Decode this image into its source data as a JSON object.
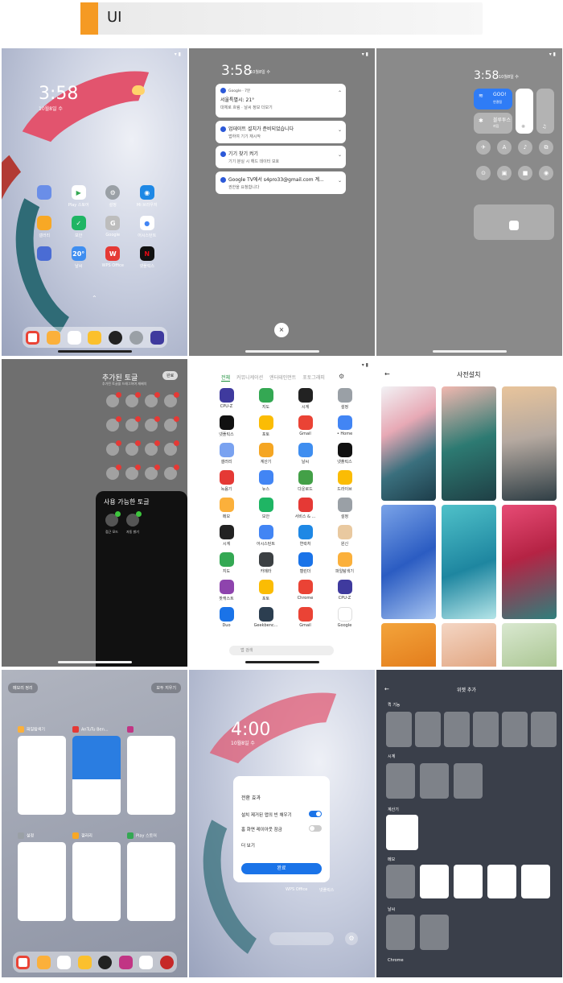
{
  "header": {
    "label": "UI"
  },
  "home": {
    "time": "3:58",
    "date": "10월8일 수",
    "apps": [
      {
        "label": "",
        "color": "#6a8ee8"
      },
      {
        "label": "Play 스토어",
        "color": "#ffffff"
      },
      {
        "label": "설정",
        "color": "#9aa0a6"
      },
      {
        "label": "Mi 브라우저",
        "color": "#1e88e5"
      },
      {
        "label": "갤러리",
        "color": "#f8a825"
      },
      {
        "label": "보안",
        "color": "#1fb564"
      },
      {
        "label": "Google",
        "color": "#bdbdbd"
      },
      {
        "label": "어시스턴트",
        "color": "#ffffff"
      },
      {
        "label": "",
        "color": "#4a6cd4"
      },
      {
        "label": "날씨",
        "color": "#3f8ef0"
      },
      {
        "label": "WPS Office",
        "color": "#e53935"
      },
      {
        "label": "넷플릭스",
        "color": "#111111"
      }
    ]
  },
  "notifications": {
    "time": "3:58",
    "date": "10월8일 수",
    "cards": [
      {
        "title": "Google · 7분",
        "line1": "서울특별시: 21°",
        "line2": "대체로 흐림 · 날씨 정보 더보기"
      },
      {
        "title": "업데이트 설치가 준비되었습니다",
        "line1": "",
        "line2": "앱하여 기기 재시작"
      },
      {
        "title": "기기 찾기 켜기",
        "line1": "",
        "line2": "기기 분실 시 해드 데이터 보호"
      },
      {
        "title": "Google TV에서 s4pro33@gmail.com 계...",
        "line1": "",
        "line2": "권한을 요청합니다"
      }
    ],
    "close": "×"
  },
  "control": {
    "time": "3:58",
    "date": "10월8일 수",
    "wifi_label": "GOO!",
    "wifi_sub": "연결됨",
    "bt_label": "블루투스",
    "bt_sub": "꺼짐"
  },
  "toggles": {
    "title": "추가된 토글",
    "subtitle": "추가된 토글을 드래그하여 재배치",
    "done": "완료",
    "panel_title": "사용 가능한 토글",
    "panel_items": [
      "접근 모드",
      "자동 밝기"
    ]
  },
  "drawer": {
    "tabs": [
      "전체",
      "커뮤니케이션",
      "엔터테인먼트",
      "포토그래피"
    ],
    "apps": [
      {
        "label": "CPU-Z",
        "color": "#3f3a9e"
      },
      {
        "label": "지도",
        "color": "#34a853"
      },
      {
        "label": "시계",
        "color": "#222222"
      },
      {
        "label": "설정",
        "color": "#9aa0a6"
      },
      {
        "label": "넷플릭스",
        "color": "#111111"
      },
      {
        "label": "포토",
        "color": "#fbbc04"
      },
      {
        "label": "Gmail",
        "color": "#ea4335"
      },
      {
        "label": "• Home",
        "color": "#4285f4"
      },
      {
        "label": "갤러리",
        "color": "#7aa2f0"
      },
      {
        "label": "계산기",
        "color": "#f5a623"
      },
      {
        "label": "날씨",
        "color": "#3f8ef0"
      },
      {
        "label": "넷플릭스",
        "color": "#111111"
      },
      {
        "label": "녹음기",
        "color": "#e53935"
      },
      {
        "label": "뉴스",
        "color": "#4285f4"
      },
      {
        "label": "다운로드",
        "color": "#43a047"
      },
      {
        "label": "드라이브",
        "color": "#fbbc04"
      },
      {
        "label": "메모",
        "color": "#fbb03b"
      },
      {
        "label": "보안",
        "color": "#1fb564"
      },
      {
        "label": "서비스 & ...",
        "color": "#e53935"
      },
      {
        "label": "설정",
        "color": "#9aa0a6"
      },
      {
        "label": "시계",
        "color": "#222222"
      },
      {
        "label": "어시스턴트",
        "color": "#4285f4"
      },
      {
        "label": "연락처",
        "color": "#1e88e5"
      },
      {
        "label": "원신",
        "color": "#e9c9a0"
      },
      {
        "label": "지도",
        "color": "#34a853"
      },
      {
        "label": "카메라",
        "color": "#3c4043"
      },
      {
        "label": "캘린더",
        "color": "#1a73e8"
      },
      {
        "label": "파일탐색기",
        "color": "#fbb03b"
      },
      {
        "label": "팟캐스트",
        "color": "#8e44ad"
      },
      {
        "label": "포토",
        "color": "#fbbc04"
      },
      {
        "label": "Chrome",
        "color": "#ea4335"
      },
      {
        "label": "CPU-Z",
        "color": "#3f3a9e"
      },
      {
        "label": "Duo",
        "color": "#1a73e8"
      },
      {
        "label": "Geekbenc...",
        "color": "#2c3e50"
      },
      {
        "label": "Gmail",
        "color": "#ea4335"
      },
      {
        "label": "Google",
        "color": "#ffffff"
      }
    ],
    "search": "앱 검색"
  },
  "wallpaper": {
    "title": "사전설치",
    "back": "←"
  },
  "recents": {
    "left_button": "메모리 정리",
    "right_button": "모두 지우기",
    "cards": [
      {
        "label": "파일탐색기",
        "color": "#fbb03b"
      },
      {
        "label": "AnTuTu Ben...",
        "color": "#e53935"
      },
      {
        "label": "",
        "color": "#c13584"
      },
      {
        "label": "설정",
        "color": "#9aa0a6"
      },
      {
        "label": "갤러리",
        "color": "#f8a825"
      },
      {
        "label": "Play 스토어",
        "color": "#34a853"
      }
    ]
  },
  "dialog": {
    "time": "4:00",
    "date": "10월8일 수",
    "title": "전환 효과",
    "row1": "설치 제거된 앱의 빈 채우기",
    "row2": "홈 화면 레이아웃 잠금",
    "row3": "더 보기",
    "ok": "완료",
    "apps": [
      "부저",
      "WPS Office",
      "넷플릭스"
    ]
  },
  "widgets": {
    "title": "위젯 추가",
    "sec1": "퀵 기능",
    "sec2": "시계",
    "sec3": "계산기",
    "sec4": "메모",
    "sec5": "날씨",
    "sec6": "Chrome"
  }
}
